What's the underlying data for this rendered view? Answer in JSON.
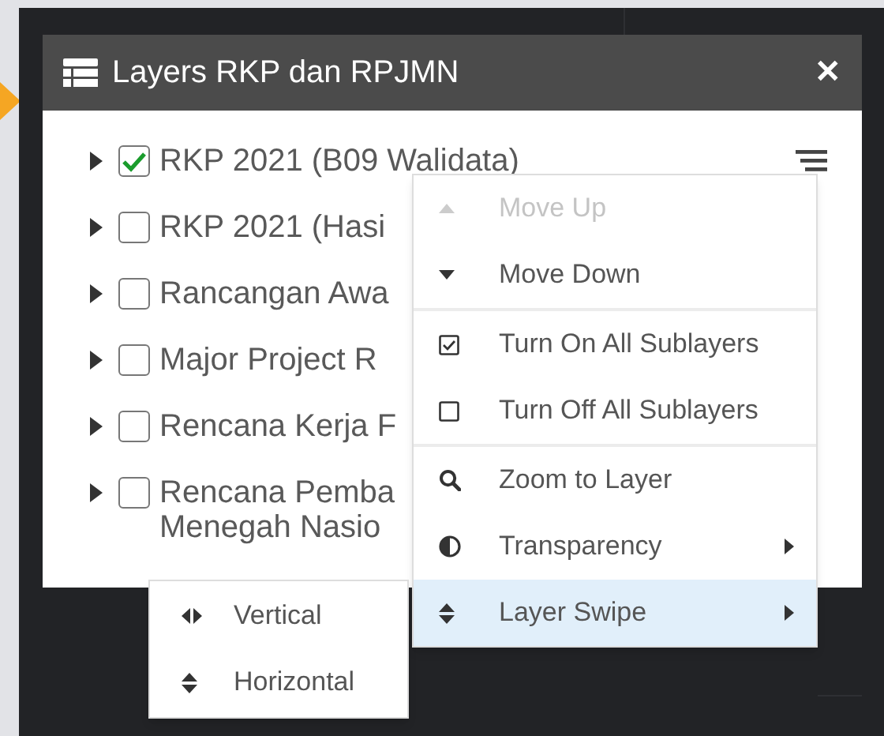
{
  "panel": {
    "title": "Layers RKP dan RPJMN",
    "close": "✕"
  },
  "layers": [
    {
      "lines": [
        "RKP 2021 (B09 Walidata)"
      ],
      "checked": true,
      "menu_button": true
    },
    {
      "lines": [
        "RKP 2021 (Hasi"
      ],
      "checked": false,
      "menu_button": false
    },
    {
      "lines": [
        "Rancangan Awa"
      ],
      "checked": false,
      "menu_button": false
    },
    {
      "lines": [
        "Major Project R"
      ],
      "checked": false,
      "menu_button": false
    },
    {
      "lines": [
        "Rencana Kerja F"
      ],
      "checked": false,
      "menu_button": false
    },
    {
      "lines": [
        "Rencana Pemba",
        "Menegah Nasio"
      ],
      "checked": false,
      "menu_button": false
    }
  ],
  "context_menu": {
    "groups": [
      [
        {
          "kind": "up",
          "label": "Move Up",
          "disabled": true,
          "selected": false,
          "submenu": false
        },
        {
          "kind": "down",
          "label": "Move Down",
          "disabled": false,
          "selected": false,
          "submenu": false
        }
      ],
      [
        {
          "kind": "checked",
          "label": "Turn On All Sublayers",
          "disabled": false,
          "selected": false,
          "submenu": false
        },
        {
          "kind": "unchecked",
          "label": "Turn Off All Sublayers",
          "disabled": false,
          "selected": false,
          "submenu": false
        }
      ],
      [
        {
          "kind": "zoom",
          "label": "Zoom to Layer",
          "disabled": false,
          "selected": false,
          "submenu": false
        },
        {
          "kind": "contrast",
          "label": "Transparency",
          "disabled": false,
          "selected": false,
          "submenu": true
        },
        {
          "kind": "updown",
          "label": "Layer Swipe",
          "disabled": false,
          "selected": true,
          "submenu": true
        }
      ]
    ]
  },
  "submenu": [
    {
      "kind": "leftright",
      "label": "Vertical"
    },
    {
      "kind": "updown",
      "label": "Horizontal"
    }
  ]
}
